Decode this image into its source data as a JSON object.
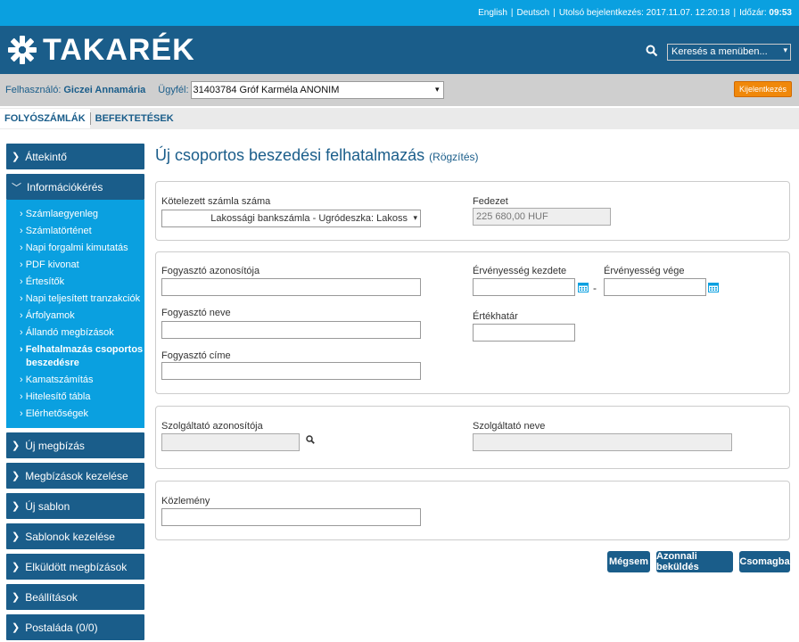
{
  "topbar": {
    "lang_en": "English",
    "lang_de": "Deutsch",
    "last_login_label": "Utolsó bejelentkezés:",
    "last_login_value": "2017.11.07. 12:20:18",
    "time_label": "Időzár:",
    "time_value": "09:53"
  },
  "header": {
    "logo_text": "TAKARÉK",
    "menu_search_value": "Keresés a menüben..."
  },
  "userbar": {
    "user_label": "Felhasználó:",
    "user_name": "Giczei Annamária",
    "client_label": "Ügyfél:",
    "client_value": "31403784 Gróf Karméla ANONIM",
    "logout_label": "Kijelentkezés"
  },
  "tabs": [
    {
      "label": "FOLYÓSZÁMLÁK"
    },
    {
      "label": "BEFEKTETÉSEK"
    }
  ],
  "sidebar": {
    "items": [
      {
        "label": "Áttekintő"
      },
      {
        "label": "Információkérés"
      },
      {
        "label": "Új megbízás"
      },
      {
        "label": "Megbízások kezelése"
      },
      {
        "label": "Új sablon"
      },
      {
        "label": "Sablonok kezelése"
      },
      {
        "label": "Elküldött megbízások"
      },
      {
        "label": "Beállítások"
      },
      {
        "label": "Postaláda (0/0)"
      }
    ],
    "subitems": [
      {
        "label": "› Számlaegyenleg"
      },
      {
        "label": "› Számlatörténet"
      },
      {
        "label": "› Napi forgalmi kimutatás"
      },
      {
        "label": "› PDF kivonat"
      },
      {
        "label": "› Értesítők"
      },
      {
        "label": "› Napi teljesített tranzakciók"
      },
      {
        "label": "› Árfolyamok"
      },
      {
        "label": "› Állandó megbízások"
      },
      {
        "label": "› Felhatalmazás csoportos"
      },
      {
        "label": "beszedésre"
      },
      {
        "label": "› Kamatszámítás"
      },
      {
        "label": "› Hitelesítő tábla"
      },
      {
        "label": "› Elérhetőségek"
      }
    ]
  },
  "page": {
    "title": "Új csoportos beszedési felhatalmazás",
    "subtitle": "(Rögzítés)"
  },
  "form": {
    "account_label": "Kötelezett számla száma",
    "account_value": "Lakossági bankszámla - Ugródeszka: Lakoss",
    "coverage_label": "Fedezet",
    "coverage_value": "225 680,00 HUF",
    "consumer_id_label": "Fogyasztó azonosítója",
    "consumer_name_label": "Fogyasztó neve",
    "consumer_address_label": "Fogyasztó címe",
    "valid_from_label": "Érvényesség kezdete",
    "valid_to_label": "Érvényesség vége",
    "dash": "-",
    "limit_label": "Értékhatár",
    "provider_id_label": "Szolgáltató azonosítója",
    "provider_name_label": "Szolgáltató neve",
    "comment_label": "Közlemény"
  },
  "buttons": {
    "cancel": "Mégsem",
    "send_now": "Azonnali beküldés",
    "package": "Csomagba"
  }
}
